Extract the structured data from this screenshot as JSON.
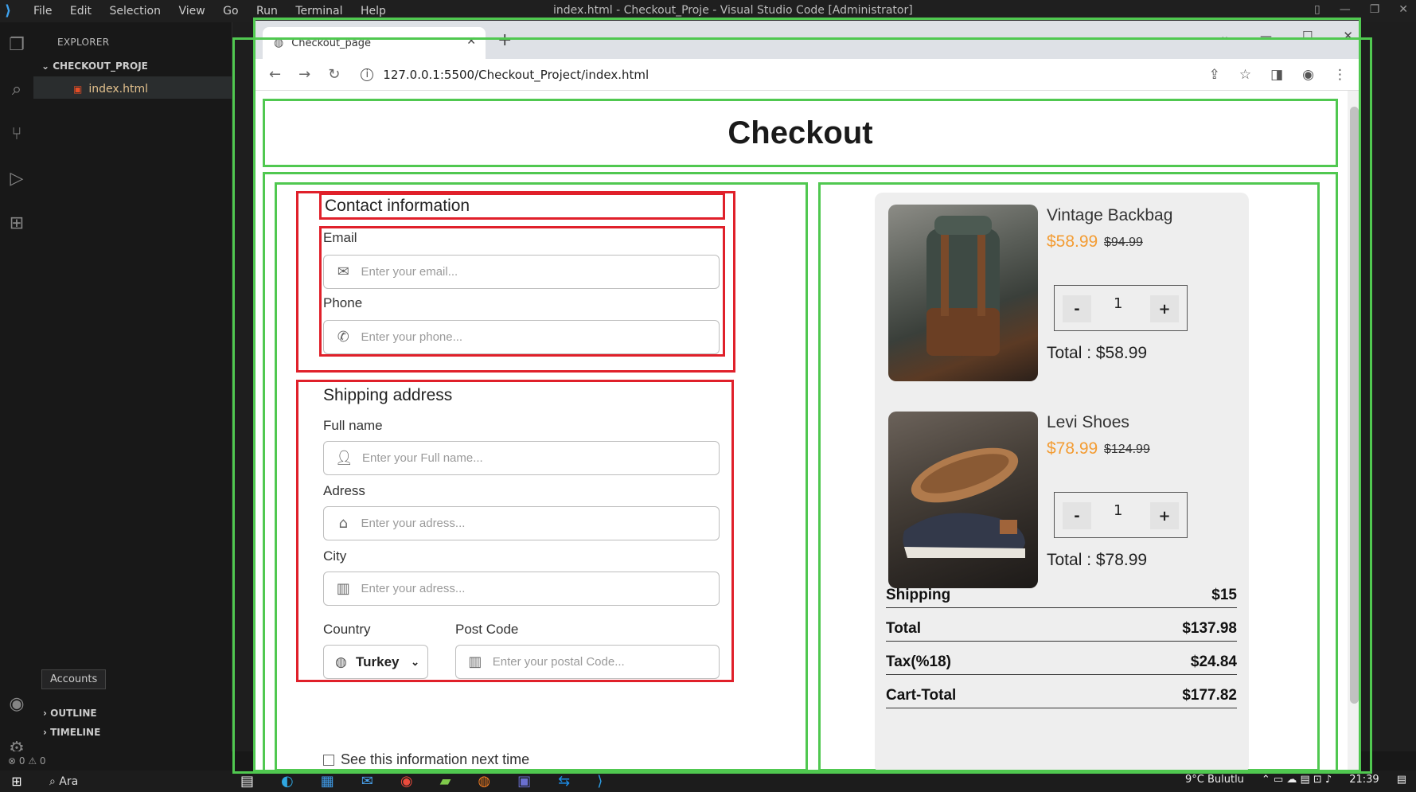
{
  "vscode": {
    "menu": [
      "File",
      "Edit",
      "Selection",
      "View",
      "Go",
      "Run",
      "Terminal",
      "Help"
    ],
    "window_title": "index.html - Checkout_Proje - Visual Studio Code [Administrator]",
    "explorer_title": "EXPLORER",
    "folder": "CHECKOUT_PROJE",
    "file": "index.html",
    "accounts_tooltip": "Accounts",
    "outline": "OUTLINE",
    "timeline": "TIMELINE",
    "status": "⊗ 0 ⚠ 0"
  },
  "browser": {
    "tab_title": "Checkout_page",
    "url": "127.0.0.1:5500/Checkout_Project/index.html"
  },
  "page": {
    "title": "Checkout",
    "contact": {
      "title": "Contact information",
      "email_label": "Email",
      "email_placeholder": "Enter your email...",
      "phone_label": "Phone",
      "phone_placeholder": "Enter your phone..."
    },
    "shipping": {
      "title": "Shipping address",
      "fullname_label": "Full name",
      "fullname_placeholder": "Enter your Full name...",
      "address_label": "Adress",
      "address_placeholder": "Enter your adress...",
      "city_label": "City",
      "city_placeholder": "Enter your adress...",
      "country_label": "Country",
      "country_value": "Turkey",
      "postcode_label": "Post Code",
      "postcode_placeholder": "Enter your postal Code..."
    },
    "save_info": "See this information next time",
    "cart": {
      "items": [
        {
          "name": "Vintage Backbag",
          "price": "$58.99",
          "old_price": "$94.99",
          "qty": "1",
          "minus": "-",
          "plus": "+",
          "total": "Total : $58.99"
        },
        {
          "name": "Levi Shoes",
          "price": "$78.99",
          "old_price": "$124.99",
          "qty": "1",
          "minus": "-",
          "plus": "+",
          "total": "Total : $78.99"
        }
      ],
      "summary": [
        {
          "label": "Shipping",
          "value": "$15"
        },
        {
          "label": "Total",
          "value": "$137.98"
        },
        {
          "label": "Tax(%18)",
          "value": "$24.84"
        },
        {
          "label": "Cart-Total",
          "value": "$177.82"
        }
      ]
    }
  },
  "taskbar": {
    "search": "Ara",
    "weather": "9°C Bulutlu",
    "time": "21:39"
  },
  "colors": {
    "accent_orange": "#f39c33",
    "outline_green": "#50c850",
    "outline_red": "#e0202a"
  }
}
